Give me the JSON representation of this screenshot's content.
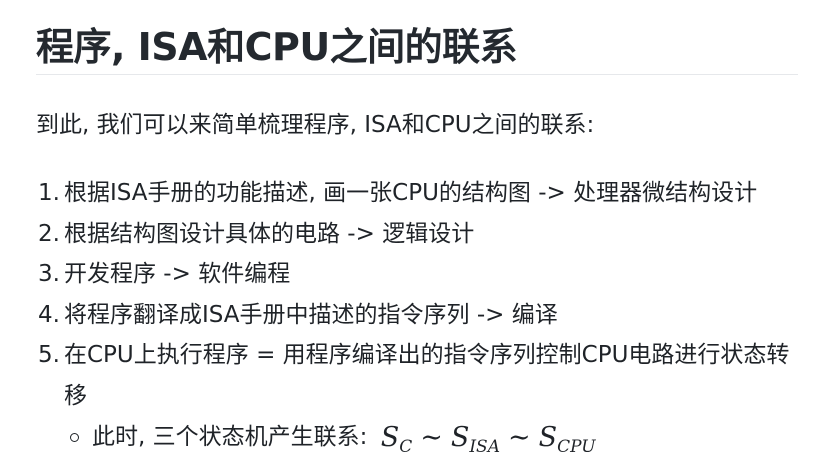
{
  "title": "程序, ISA和CPU之间的联系",
  "intro": "到此, 我们可以来简单梳理程序, ISA和CPU之间的联系:",
  "steps": [
    {
      "num": "1.",
      "text": "根据ISA手册的功能描述, 画一张CPU的结构图 -> 处理器微结构设计"
    },
    {
      "num": "2.",
      "text": "根据结构图设计具体的电路 -> 逻辑设计"
    },
    {
      "num": "3.",
      "text": "开发程序 -> 软件编程"
    },
    {
      "num": "4.",
      "text": "将程序翻译成ISA手册中描述的指令序列 -> 编译"
    },
    {
      "num": "5.",
      "text": "在CPU上执行程序 = 用程序编译出的指令序列控制CPU电路进行状态转移"
    }
  ],
  "sub_item": {
    "text": "此时, 三个状态机产生联系:",
    "math": {
      "symbol": "S",
      "sub1": "C",
      "sub2": "ISA",
      "sub3": "CPU",
      "op": "∼"
    }
  }
}
